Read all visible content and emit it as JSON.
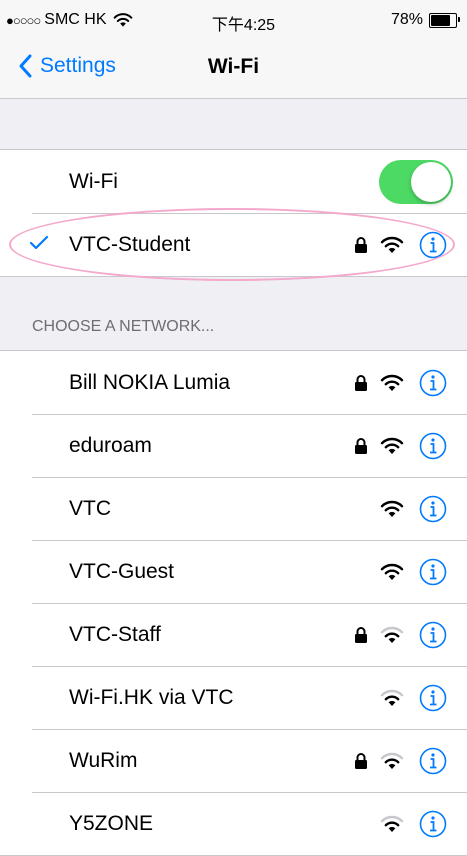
{
  "status_bar": {
    "signal": "●○○○○",
    "carrier": "SMC HK",
    "time": "下午4:25",
    "battery_percent": "78%",
    "battery_level": 0.78
  },
  "nav": {
    "back_label": "Settings",
    "title": "Wi-Fi"
  },
  "wifi_toggle": {
    "label": "Wi-Fi",
    "on": true,
    "color": "#4cd964"
  },
  "connected_network": {
    "name": "VTC-Student",
    "secured": true,
    "icons": [
      "checkmark-icon",
      "lock-icon",
      "wifi-icon",
      "info-icon"
    ]
  },
  "section_header": "CHOOSE A NETWORK...",
  "networks": [
    {
      "name": "Bill NOKIA Lumia",
      "secured": true,
      "signal": "full"
    },
    {
      "name": "eduroam",
      "secured": true,
      "signal": "full"
    },
    {
      "name": "VTC",
      "secured": false,
      "signal": "full"
    },
    {
      "name": "VTC-Guest",
      "secured": false,
      "signal": "full"
    },
    {
      "name": "VTC-Staff",
      "secured": true,
      "signal": "medium"
    },
    {
      "name": "Wi-Fi.HK via VTC",
      "secured": false,
      "signal": "medium"
    },
    {
      "name": "WuRim",
      "secured": true,
      "signal": "medium"
    },
    {
      "name": "Y5ZONE",
      "secured": false,
      "signal": "medium"
    }
  ],
  "colors": {
    "accent": "#007aff",
    "toggle_on": "#4cd964",
    "background": "#efeff4",
    "highlight": "#f4a8cc"
  }
}
